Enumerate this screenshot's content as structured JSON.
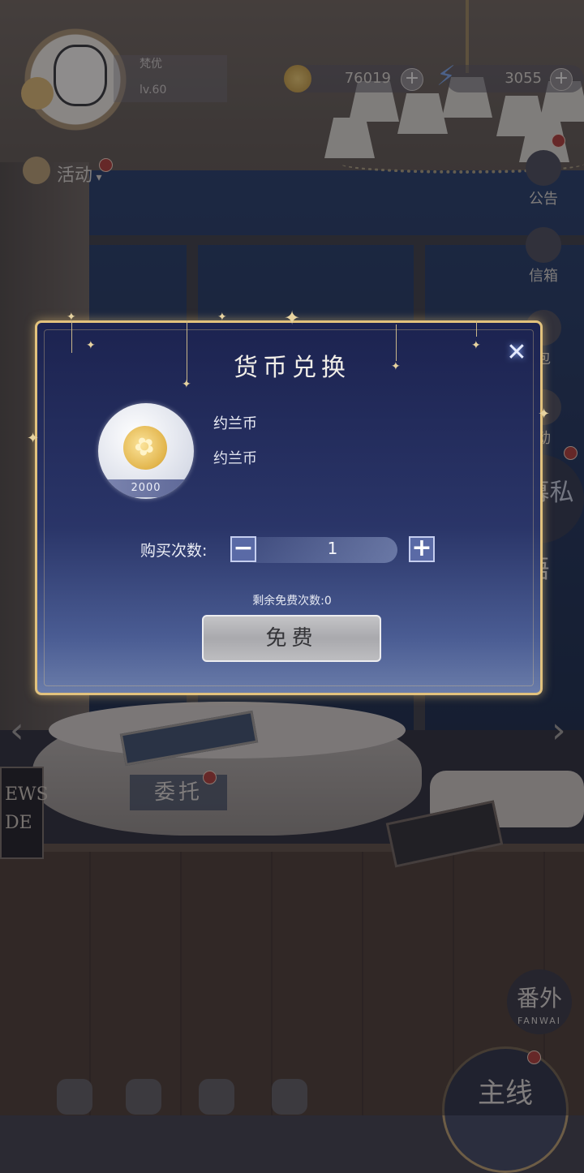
{
  "hud": {
    "player_name": "梵优",
    "level": "lv.60",
    "gold": "76019",
    "energy": "3055",
    "activity_label": "活动",
    "announce_label": "公告",
    "mail_label": "信箱",
    "bag_label": "包",
    "gift_label": "动",
    "event_banner": "帷幕私语",
    "commission_label": "委托",
    "extra_label": "番外",
    "extra_sub": "FANWAI",
    "main_story_label": "主线",
    "plus": "+",
    "poster_text_1": "EWS",
    "poster_text_2": "DE"
  },
  "dialog": {
    "title": "货币兑换",
    "close_symbol": "✕",
    "item_name": "约兰币",
    "item_desc": "约兰币",
    "item_quantity": "2000",
    "coin_glyph": "✿",
    "buy_count_label": "购买次数:",
    "buy_count_value": "1",
    "minus": "−",
    "plus": "+",
    "remaining_free": "剩余免费次数:0",
    "free_button": "免费"
  },
  "colors": {
    "dialog_border": "#e2c27d",
    "dialog_bg_top": "#1c2350",
    "dialog_bg_bottom": "#6a7ca9",
    "stepper_button": "#5a6aa6",
    "free_button": "#b4b4b7"
  }
}
